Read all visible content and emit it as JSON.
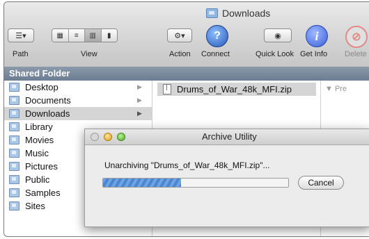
{
  "window": {
    "title": "Downloads"
  },
  "toolbar": {
    "path_label": "Path",
    "view_label": "View",
    "action_label": "Action",
    "connect_label": "Connect",
    "quicklook_label": "Quick Look",
    "getinfo_label": "Get Info",
    "delete_label": "Delete"
  },
  "sidebar": {
    "header": "Shared Folder",
    "items": [
      {
        "label": "Desktop",
        "icon": "folder-icon"
      },
      {
        "label": "Documents",
        "icon": "folder-icon"
      },
      {
        "label": "Downloads",
        "icon": "folder-icon"
      },
      {
        "label": "Library",
        "icon": "folder-icon"
      },
      {
        "label": "Movies",
        "icon": "folder-icon"
      },
      {
        "label": "Music",
        "icon": "folder-icon"
      },
      {
        "label": "Pictures",
        "icon": "folder-icon"
      },
      {
        "label": "Public",
        "icon": "folder-icon"
      },
      {
        "label": "Samples",
        "icon": "folder-icon"
      },
      {
        "label": "Sites",
        "icon": "folder-icon"
      }
    ]
  },
  "file_column": {
    "file": "Drums_of_War_48k_MFI.zip"
  },
  "preview": {
    "label": "Pre"
  },
  "dialog": {
    "title": "Archive Utility",
    "message": "Unarchiving \"Drums_of_War_48k_MFI.zip\"...",
    "cancel_label": "Cancel",
    "progress": 0.42
  },
  "colors": {
    "accent": "#4b86d3",
    "header_bar": "#7a899d"
  }
}
